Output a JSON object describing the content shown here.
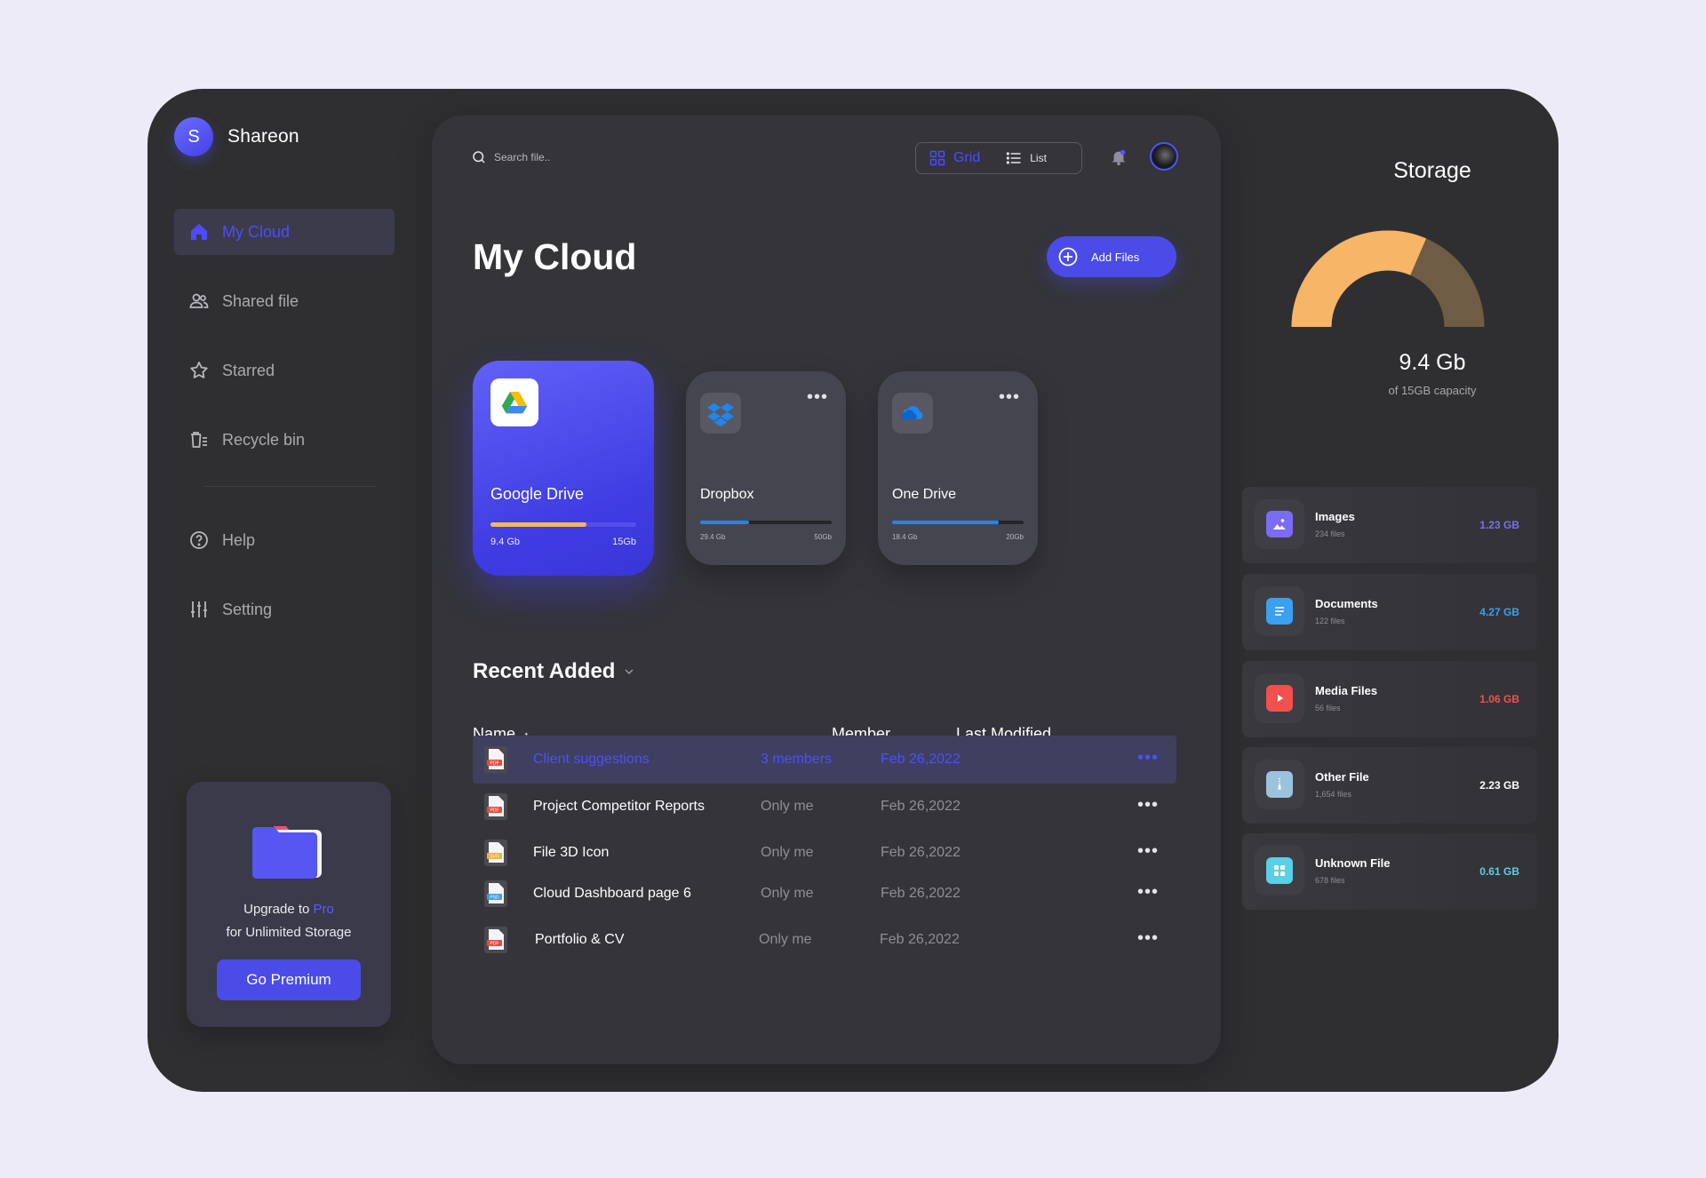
{
  "brand": {
    "logo_letter": "S",
    "name": "Shareon"
  },
  "nav": {
    "items": [
      {
        "label": "My Cloud",
        "icon": "home-icon",
        "active": true
      },
      {
        "label": "Shared file",
        "icon": "users-icon"
      },
      {
        "label": "Starred",
        "icon": "star-icon"
      },
      {
        "label": "Recycle bin",
        "icon": "trash-icon"
      },
      {
        "label": "Help",
        "icon": "help-icon"
      },
      {
        "label": "Setting",
        "icon": "sliders-icon"
      }
    ]
  },
  "upgrade": {
    "line1_prefix": "Upgrade to ",
    "line1_highlight": "Pro",
    "line2": "for Unlimited Storage",
    "button": "Go Premium"
  },
  "toolbar": {
    "search_placeholder": "Search file..",
    "view_grid": "Grid",
    "view_list": "List"
  },
  "main": {
    "title": "My Cloud",
    "add_button": "Add Files"
  },
  "clouds": [
    {
      "name": "Google Drive",
      "used": "9.4 Gb",
      "total": "15Gb",
      "progress": 0.66,
      "bar_color": "#f6b567",
      "icon": "google-drive-icon"
    },
    {
      "name": "Dropbox",
      "used": "29.4 Gb",
      "total": "50Gb",
      "progress": 0.37,
      "bar_color": "#1f86f0",
      "icon": "dropbox-icon"
    },
    {
      "name": "One Drive",
      "used": "18.4 Gb",
      "total": "20Gb",
      "progress": 0.81,
      "bar_color": "#1f86f0",
      "icon": "onedrive-icon"
    }
  ],
  "recent": {
    "title": "Recent Added",
    "columns": {
      "name": "Name",
      "sort_arrow": "↑",
      "member": "Member",
      "modified": "Last Modified"
    },
    "rows": [
      {
        "name": "Client suggestions",
        "member": "3 members",
        "modified": "Feb 26,2022",
        "type": "PDF",
        "type_color": "#e94b3c",
        "selected": true
      },
      {
        "name": "Project Competitor Reports",
        "member": "Only me",
        "modified": "Feb 26,2022",
        "type": "PDF",
        "type_color": "#e94b3c"
      },
      {
        "name": "File 3D Icon",
        "member": "Only me",
        "modified": "Feb 26,2022",
        "type": "SVG",
        "type_color": "#f2b035"
      },
      {
        "name": "Cloud Dashboard page 6",
        "member": "Only me",
        "modified": "Feb 26,2022",
        "type": "PSD",
        "type_color": "#3aa0e8"
      },
      {
        "name": "Portfolio & CV",
        "member": "Only me",
        "modified": "Feb 26,2022",
        "type": "PDF",
        "type_color": "#e94b3c"
      }
    ],
    "row_menu": "•••"
  },
  "storage": {
    "title": "Storage",
    "amount": "9.4 Gb",
    "capacity": "of 15GB capacity",
    "used_fraction": 0.63,
    "colors": {
      "used": "#f6b567",
      "free": "#6e5c44"
    },
    "categories": [
      {
        "name": "Images",
        "count": "234 files",
        "size": "1.23 GB",
        "color": "#7b6cf6",
        "icon": "image-icon"
      },
      {
        "name": "Documents",
        "count": "122 files",
        "size": "4.27 GB",
        "color": "#3aa0f0",
        "icon": "document-icon"
      },
      {
        "name": "Media Files",
        "count": "56 files",
        "size": "1.06 GB",
        "color": "#f0514d",
        "icon": "play-icon"
      },
      {
        "name": "Other File",
        "count": "1,654 files",
        "size": "2.23 GB",
        "color": "#9cc3dd",
        "icon": "zip-icon"
      },
      {
        "name": "Unknown File",
        "count": "678 files",
        "size": "0.61 GB",
        "color": "#58d0e6",
        "icon": "grid-icon"
      }
    ]
  }
}
